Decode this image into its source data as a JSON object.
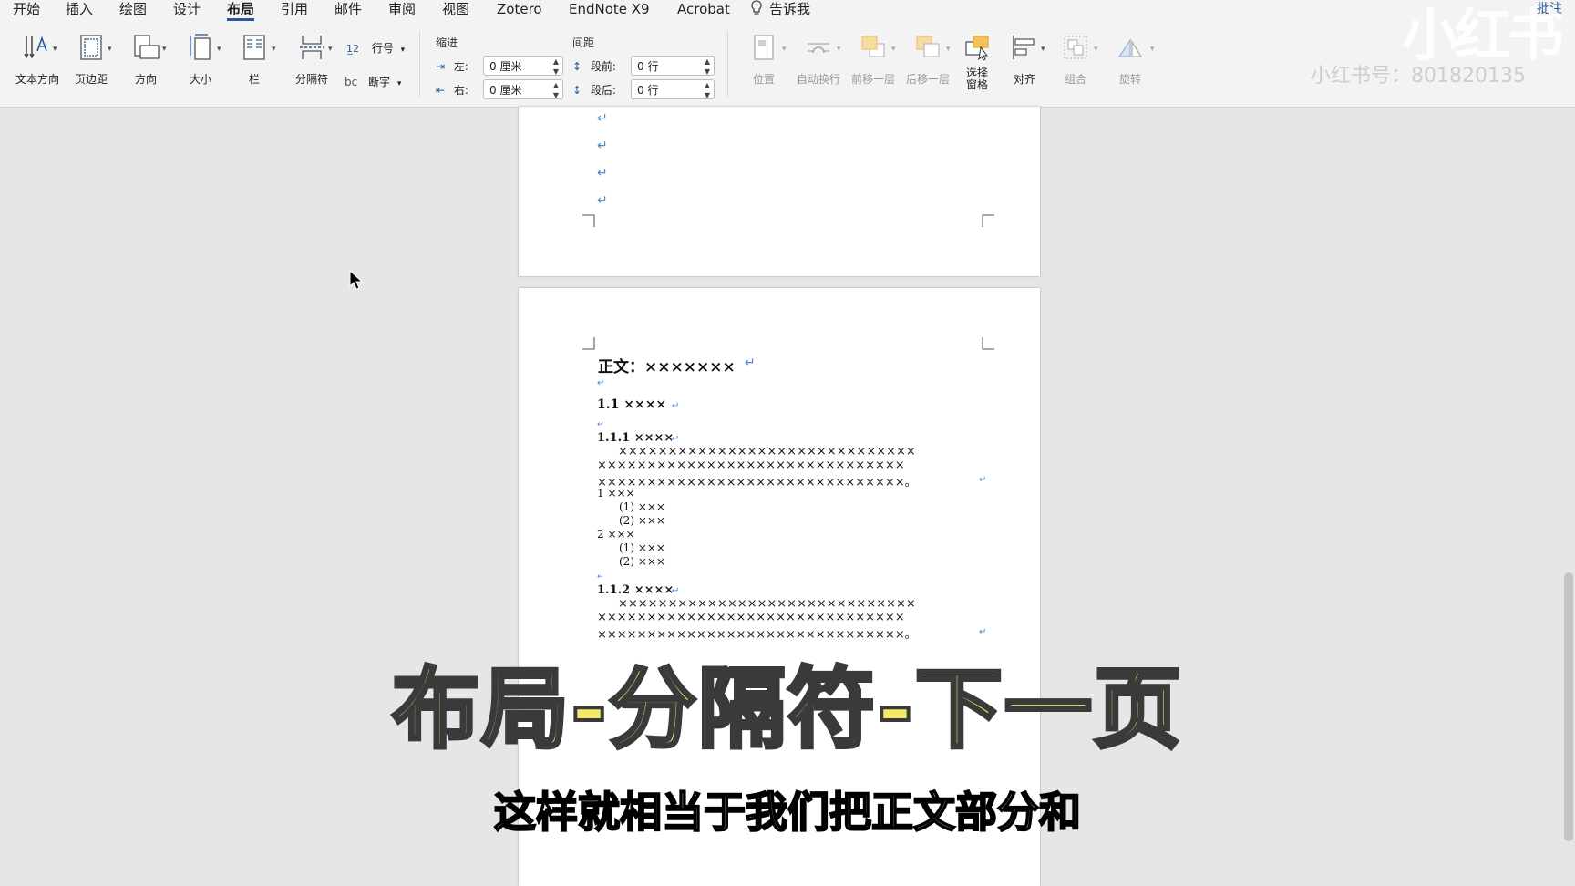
{
  "menu": {
    "items": [
      "开始",
      "插入",
      "绘图",
      "设计",
      "布局",
      "引用",
      "邮件",
      "审阅",
      "视图",
      "Zotero",
      "EndNote X9",
      "Acrobat",
      "告诉我"
    ],
    "active_index": 4,
    "right_text": "批注"
  },
  "ribbon": {
    "page_setup": [
      "文本方向",
      "页边距",
      "方向",
      "大小",
      "栏",
      "分隔符"
    ],
    "line_numbers": "行号",
    "hyphenation": "断字",
    "indent": {
      "title": "缩进",
      "left_label": "左:",
      "left_value": "0 厘米",
      "right_label": "右:",
      "right_value": "0 厘米"
    },
    "spacing": {
      "title": "间距",
      "before_label": "段前:",
      "before_value": "0 行",
      "after_label": "段后:",
      "after_value": "0 行"
    },
    "arrange": [
      "位置",
      "自动换行",
      "前移一层",
      "后移一层",
      "选择\n窗格",
      "对齐",
      "组合",
      "旋转"
    ]
  },
  "document": {
    "heading": "正文：×××××××",
    "h1": "1.1 ××××",
    "h2a": "1.1.1 ××××",
    "para_a": [
      "××××××××××××××××××××××××××××××",
      "×××××××××××××××××××××××××××××××",
      "×××××××××××××××××××××××××××××××。"
    ],
    "list_1": "1 ×××",
    "list_1_sub": [
      "(1) ×××",
      "(2) ×××"
    ],
    "list_2": "2 ×××",
    "list_2_sub": [
      "(1) ×××",
      "(2) ×××"
    ],
    "h2b": "1.1.2 ××××",
    "para_b": [
      "××××××××××××××××××××××××××××××",
      "×××××××××××××××××××××××××××××××",
      "×××××××××××××××××××××××××××××××。"
    ]
  },
  "watermark": {
    "logo": "小红书",
    "id": "小红书号：801820135"
  },
  "caption": {
    "title": "布局-分隔符-下一页",
    "subtitle": "这样就相当于我们把正文部分和"
  },
  "colors": {
    "accent": "#2b579a",
    "paragraph_mark": "#4a86c8",
    "caption_yellow": "#f5e96a"
  }
}
